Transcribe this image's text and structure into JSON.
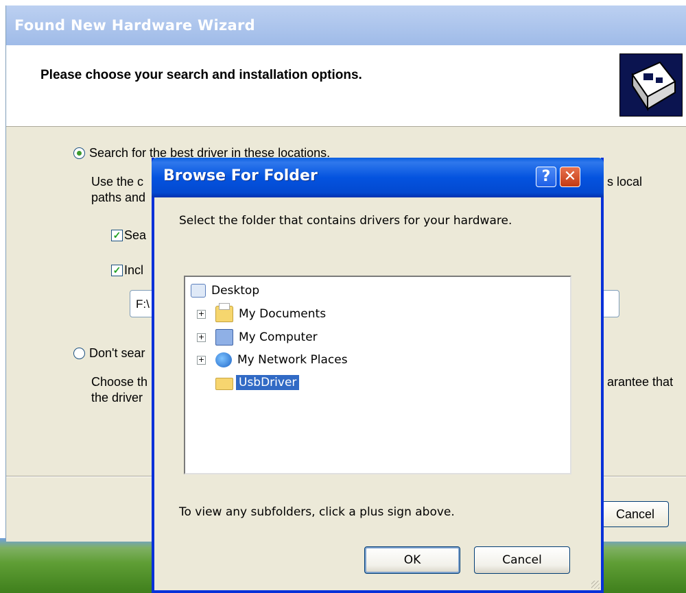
{
  "wizard": {
    "title": "Found New Hardware Wizard",
    "header_title": "Please choose your search and installation options.",
    "option_search": "Search for the best driver in these locations.",
    "option_search_desc_1": "Use the c",
    "option_search_desc_1_tail": "s local",
    "option_search_desc_2": "paths and",
    "check_removable": "Sea",
    "check_include": "Incl",
    "path_value": "F:\\",
    "option_dont_search": "Don't sear",
    "dont_search_desc_1": "Choose th",
    "dont_search_desc_1_tail": "arantee that",
    "dont_search_desc_2": "the driver",
    "cancel_label": "Cancel"
  },
  "dialog": {
    "title": "Browse For Folder",
    "help_label": "?",
    "close_label": "✕",
    "prompt": "Select the folder that contains drivers for your hardware.",
    "tree": [
      {
        "label": "Desktop",
        "icon": "desktop-icon",
        "expander": false,
        "selected": false
      },
      {
        "label": "My Documents",
        "icon": "my-documents-icon",
        "expander": true,
        "selected": false
      },
      {
        "label": "My Computer",
        "icon": "my-computer-icon",
        "expander": true,
        "selected": false
      },
      {
        "label": "My Network Places",
        "icon": "network-places-icon",
        "expander": true,
        "selected": false
      },
      {
        "label": "UsbDriver",
        "icon": "folder-icon",
        "expander": false,
        "selected": true
      }
    ],
    "hint": "To view any subfolders, click a plus sign above.",
    "ok_label": "OK",
    "cancel_label": "Cancel"
  },
  "colors": {
    "selection": "#316ac5",
    "titlebar_blue": "#0453df",
    "close_red": "#c33a12",
    "dialog_bg": "#ece9d8"
  }
}
